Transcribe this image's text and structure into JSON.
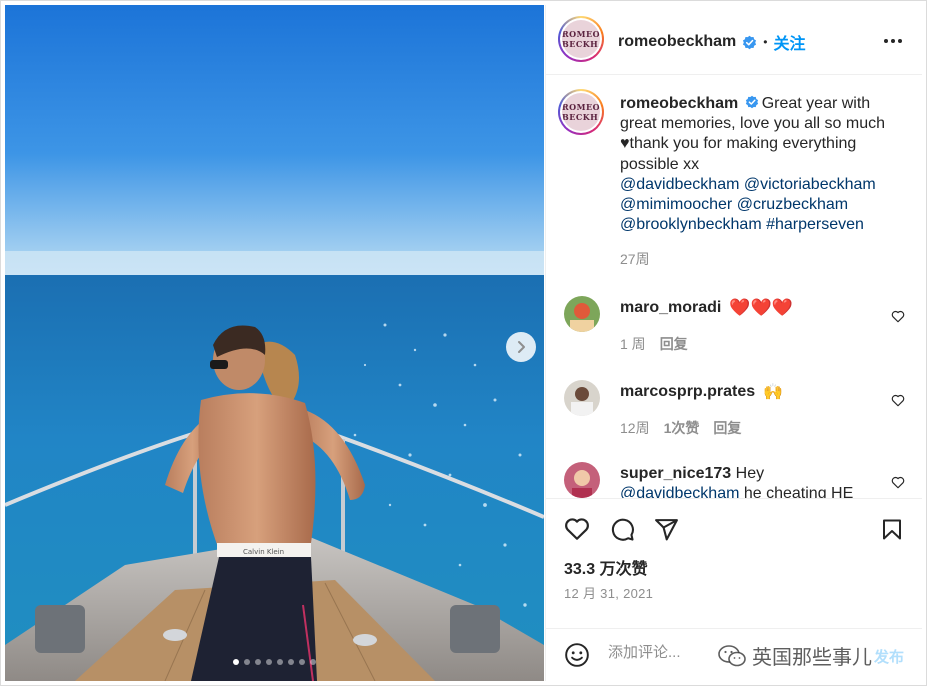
{
  "post": {
    "username": "romeobeckham",
    "follow_label": "关注",
    "separator": "•",
    "avatar_text": [
      "ROMEO",
      "BECKHAM"
    ],
    "caption_prefix": "Great year with great memories, love you all so much ",
    "caption_heart": "♥",
    "caption_suffix": "thank you for making everything possible xx",
    "mentions": [
      "@davidbeckham",
      "@victoriabeckham",
      "@mimimoocher",
      "@cruzbeckham",
      "@brooklynbeckham",
      "#harperseven"
    ],
    "caption_time": "27周",
    "image_count": 8,
    "active_image": 1
  },
  "comments": [
    {
      "username": "maro_moradi",
      "text": "❤️❤️❤️",
      "time": "1 周",
      "likes_label": "",
      "reply_label": "回复"
    },
    {
      "username": "marcosprp.prates",
      "text": "🙌",
      "time": "12周",
      "likes_label": "1次赞",
      "reply_label": "回复"
    },
    {
      "username": "super_nice173",
      "text": "Hey",
      "mention": "@davidbeckham",
      "rest": " he cheating HE"
    }
  ],
  "actions": {
    "likes": "33.3 万次赞",
    "date": "12 月 31, 2021"
  },
  "add_comment": {
    "placeholder": "添加评论...",
    "post_label": "发布",
    "watermark": "英国那些事儿"
  },
  "colors": {
    "accent": "#0095f6",
    "link": "#00376b",
    "like_red": "#ed4956",
    "muted": "#8e8e8e"
  },
  "icons": [
    "verified-badge-icon",
    "more-options-icon",
    "heart-icon",
    "comment-icon",
    "share-icon",
    "bookmark-icon",
    "emoji-icon",
    "next-image-icon",
    "wechat-icon"
  ]
}
